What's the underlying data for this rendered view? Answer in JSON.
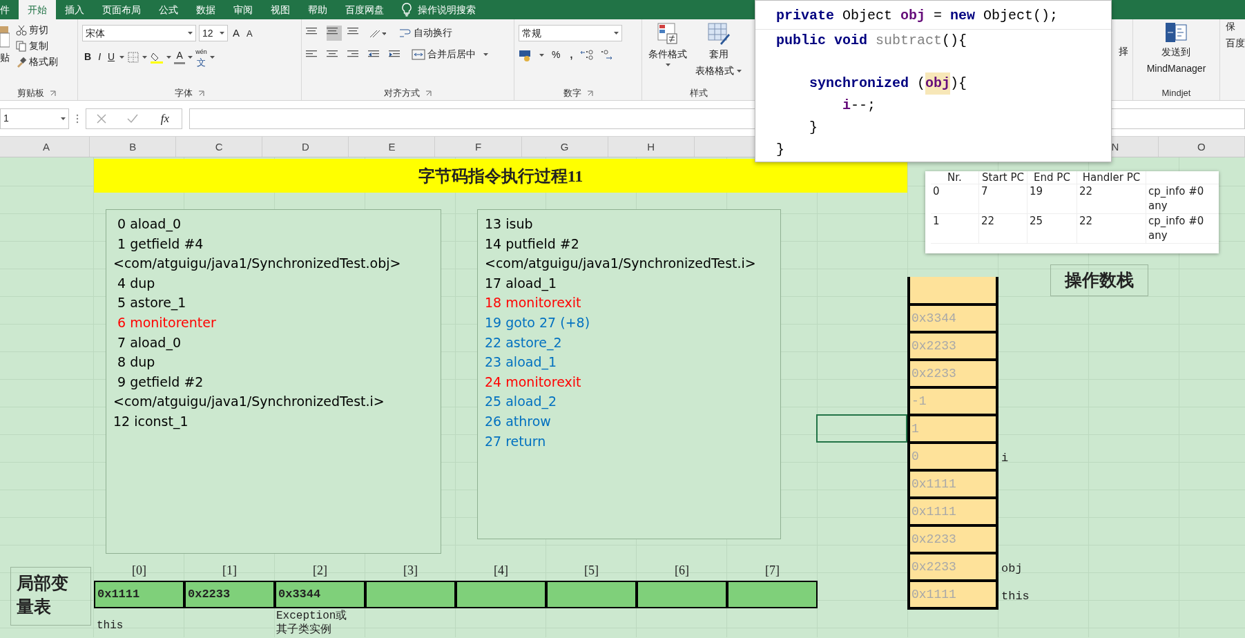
{
  "ribbon_tabs": [
    {
      "label": "件",
      "selected": false
    },
    {
      "label": "开始",
      "selected": true
    },
    {
      "label": "插入",
      "selected": false
    },
    {
      "label": "页面布局",
      "selected": false
    },
    {
      "label": "公式",
      "selected": false
    },
    {
      "label": "数据",
      "selected": false
    },
    {
      "label": "审阅",
      "selected": false
    },
    {
      "label": "视图",
      "selected": false
    },
    {
      "label": "帮助",
      "selected": false
    },
    {
      "label": "百度网盘",
      "selected": false
    }
  ],
  "tell_me": "操作说明搜索",
  "ribbon": {
    "clipboard": {
      "paste": "贴",
      "cut": "剪切",
      "copy": "复制",
      "format_painter": "格式刷",
      "label": "剪贴板"
    },
    "font": {
      "name": "宋体",
      "size": "12",
      "grow": "A",
      "shrink": "A",
      "bold": "B",
      "italic": "I",
      "underline": "U",
      "font_color_letter": "A",
      "phonetic_top": "wén",
      "phonetic_bottom": "文",
      "label": "字体"
    },
    "alignment": {
      "wrap": "自动换行",
      "merge": "合并后居中",
      "label": "对齐方式"
    },
    "number": {
      "format": "常规",
      "percent": "%",
      "comma": ",",
      "label": "数字"
    },
    "styles": {
      "conditional": "条件格式",
      "table_format_top": "套用",
      "table_format_bottom": "表格格式",
      "label": "样式"
    },
    "right": {
      "partial": "择",
      "send_top": "发送到",
      "send_bottom": "MindManager",
      "group": "Mindjet",
      "save_top": "保",
      "save_bottom": "百度"
    }
  },
  "formula_bar": {
    "name_box": "1",
    "fx": "fx"
  },
  "columns": [
    "A",
    "B",
    "C",
    "D",
    "E",
    "F",
    "G",
    "H",
    "N",
    "O"
  ],
  "code_popup": [
    {
      "gap_before": false,
      "tokens": [
        {
          "kind": "keyword",
          "text": "private"
        },
        {
          "kind": "plain",
          "text": " Object "
        },
        {
          "kind": "field",
          "text": "obj"
        },
        {
          "kind": "plain",
          "text": " = "
        },
        {
          "kind": "keyword",
          "text": "new"
        },
        {
          "kind": "plain",
          "text": " Object();"
        }
      ]
    },
    {
      "gap_before": false,
      "tokens": [
        {
          "kind": "keyword",
          "text": "public"
        },
        {
          "kind": "keyword",
          "text": " void"
        },
        {
          "kind": "unused",
          "text": " subtract"
        },
        {
          "kind": "plain",
          "text": "(){"
        }
      ]
    },
    {
      "gap_before": true,
      "tokens": [
        {
          "kind": "keyword",
          "text": "    synchronized"
        },
        {
          "kind": "plain",
          "text": " ("
        },
        {
          "kind": "highlight",
          "text": "obj"
        },
        {
          "kind": "plain",
          "text": "){"
        }
      ]
    },
    {
      "gap_before": false,
      "tokens": [
        {
          "kind": "field",
          "text": "        i"
        },
        {
          "kind": "plain",
          "text": "--;"
        }
      ]
    },
    {
      "gap_before": false,
      "tokens": [
        {
          "kind": "plain",
          "text": "    }"
        }
      ]
    },
    {
      "gap_before": false,
      "tokens": [
        {
          "kind": "plain",
          "text": "}"
        }
      ]
    }
  ],
  "title": "字节码指令执行过程11",
  "code_left": [
    {
      "text": " 0 aload_0",
      "color": "#000000"
    },
    {
      "text": " 1 getfield #4",
      "color": "#000000"
    },
    {
      "text": "<com/atguigu/java1/SynchronizedTest.obj>",
      "color": "#000000"
    },
    {
      "text": " 4 dup",
      "color": "#000000"
    },
    {
      "text": " 5 astore_1",
      "color": "#000000"
    },
    {
      "text": " 6 monitorenter",
      "color": "#ff0000"
    },
    {
      "text": " 7 aload_0",
      "color": "#000000"
    },
    {
      "text": " 8 dup",
      "color": "#000000"
    },
    {
      "text": " 9 getfield #2",
      "color": "#000000"
    },
    {
      "text": "<com/atguigu/java1/SynchronizedTest.i>",
      "color": "#000000"
    },
    {
      "text": "12 iconst_1",
      "color": "#000000"
    }
  ],
  "code_right": [
    {
      "text": "13 isub",
      "color": "#000000"
    },
    {
      "text": "14 putfield #2",
      "color": "#000000"
    },
    {
      "text": "<com/atguigu/java1/SynchronizedTest.i>",
      "color": "#000000"
    },
    {
      "text": "17 aload_1",
      "color": "#000000"
    },
    {
      "text": "18 monitorexit",
      "color": "#ff0000"
    },
    {
      "text": "19 goto 27 (+8)",
      "color": "#0070c0"
    },
    {
      "text": "22 astore_2",
      "color": "#0070c0"
    },
    {
      "text": "23 aload_1",
      "color": "#0070c0"
    },
    {
      "text": "24 monitorexit",
      "color": "#ff0000"
    },
    {
      "text": "25 aload_2",
      "color": "#0070c0"
    },
    {
      "text": "26 athrow",
      "color": "#0070c0"
    },
    {
      "text": "27 return",
      "color": "#0070c0"
    }
  ],
  "exception_table": {
    "columns": [
      "Nr.",
      "Start PC",
      "End PC",
      "Handler PC"
    ],
    "rows": [
      {
        "nr": "0",
        "start_pc": "7",
        "end_pc": "19",
        "handler_pc": "22",
        "type_line_1": "cp_info #0",
        "type_line_2": "any"
      },
      {
        "nr": "1",
        "start_pc": "22",
        "end_pc": "25",
        "handler_pc": "22",
        "type_line_1": "cp_info #0",
        "type_line_2": "any"
      }
    ]
  },
  "operand_stack": {
    "label": "操作数栈",
    "cells": [
      {
        "value": "0x3344"
      },
      {
        "value": "0x2233"
      },
      {
        "value": "0x2233"
      },
      {
        "value": "-1"
      },
      {
        "value": "1"
      },
      {
        "value": "0",
        "note": "i"
      },
      {
        "value": "0x1111"
      },
      {
        "value": "0x1111"
      },
      {
        "value": "0x2233"
      },
      {
        "value": "0x2233",
        "note": "obj"
      },
      {
        "value": "0x1111",
        "note": "this"
      }
    ]
  },
  "local_variables": {
    "label": "局部变量表",
    "slots": [
      {
        "index": "[0]",
        "value": "0x1111",
        "note": "this"
      },
      {
        "index": "[1]",
        "value": "0x2233"
      },
      {
        "index": "[2]",
        "value": "0x3344",
        "note_line_1": "Exception或",
        "note_line_2": "其子类实例"
      },
      {
        "index": "[3]"
      },
      {
        "index": "[4]"
      },
      {
        "index": "[5]"
      },
      {
        "index": "[6]"
      },
      {
        "index": "[7]"
      }
    ]
  }
}
